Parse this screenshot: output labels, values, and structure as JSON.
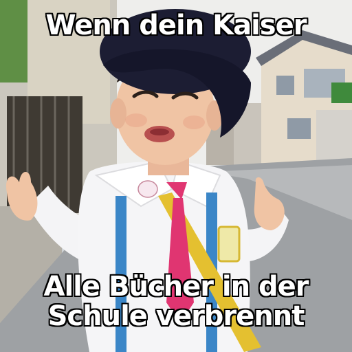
{
  "meme": {
    "top_text": "Wenn dein Kaiser",
    "bottom_line_1": "Alle Bücher in der",
    "bottom_line_2": "Schule verbrennt"
  },
  "colors": {
    "sky": "#f2f2f0",
    "road": "#9b9ea1",
    "hat": "#1c1d33",
    "skin": "#f0c4a4",
    "shirt": "#f4f4f6",
    "tie": "#e03571",
    "suspenders": "#3b86c7",
    "strap": "#e4c030"
  }
}
